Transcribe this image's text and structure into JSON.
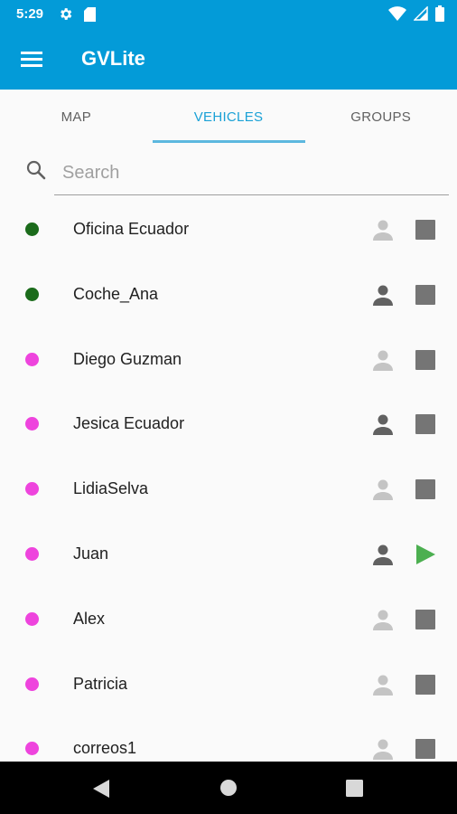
{
  "status_bar": {
    "time": "5:29",
    "icons": [
      "settings-icon",
      "sd-card-icon",
      "wifi-icon",
      "signal-icon",
      "battery-icon"
    ]
  },
  "app_bar": {
    "title": "GVLite",
    "menu_icon": "hamburger-menu-icon"
  },
  "tabs": [
    {
      "label": "MAP",
      "active": false
    },
    {
      "label": "VEHICLES",
      "active": true
    },
    {
      "label": "GROUPS",
      "active": false
    }
  ],
  "search": {
    "placeholder": "Search",
    "value": ""
  },
  "colors": {
    "primary": "#039bd8",
    "tab_active": "#1aa1d6",
    "status_online": "#1b6b1b",
    "status_offline": "#ee44dd",
    "driver_assigned": "#616161",
    "driver_unassigned": "#c4c4c4",
    "stopped": "#757575",
    "moving": "#4caf50"
  },
  "vehicles": [
    {
      "name": "Oficina Ecuador",
      "status": "online",
      "driver": "unassigned",
      "state": "stopped"
    },
    {
      "name": "Coche_Ana",
      "status": "online",
      "driver": "assigned",
      "state": "stopped"
    },
    {
      "name": "Diego Guzman",
      "status": "offline",
      "driver": "unassigned",
      "state": "stopped"
    },
    {
      "name": "Jesica Ecuador",
      "status": "offline",
      "driver": "assigned",
      "state": "stopped"
    },
    {
      "name": "LidiaSelva",
      "status": "offline",
      "driver": "unassigned",
      "state": "stopped"
    },
    {
      "name": "Juan",
      "status": "offline",
      "driver": "assigned",
      "state": "moving"
    },
    {
      "name": "Alex",
      "status": "offline",
      "driver": "unassigned",
      "state": "stopped"
    },
    {
      "name": "Patricia",
      "status": "offline",
      "driver": "unassigned",
      "state": "stopped"
    },
    {
      "name": "correos1",
      "status": "offline",
      "driver": "unassigned",
      "state": "stopped"
    }
  ],
  "nav_bar": {
    "icons": [
      "back-icon",
      "home-icon",
      "recents-icon"
    ]
  }
}
